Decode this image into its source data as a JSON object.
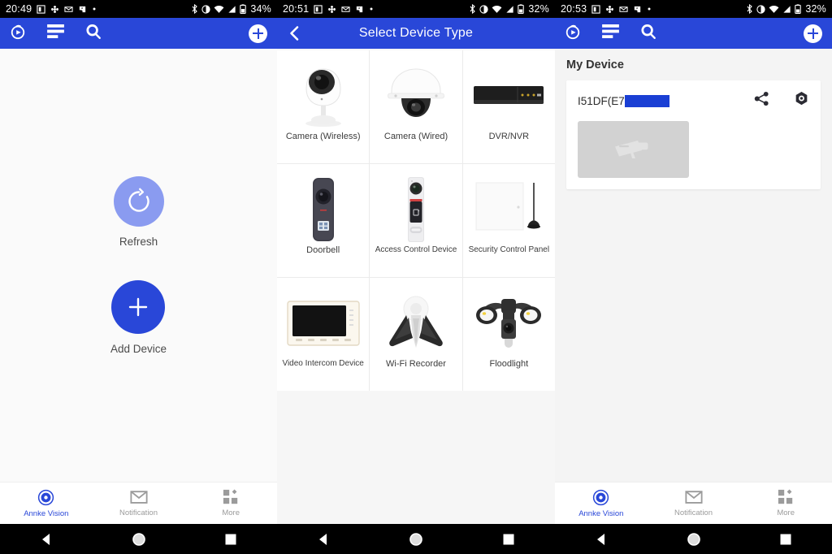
{
  "screens": [
    {
      "id": "device-list-empty",
      "status": {
        "time": "20:49",
        "battery": "34%",
        "icons": [
          "book-icon",
          "pinwheel-icon",
          "mail-icon",
          "puzzle-icon",
          "dot-icon"
        ],
        "right_icons": [
          "bluetooth-icon",
          "do-not-disturb-icon",
          "wifi-icon",
          "signal-icon",
          "battery-icon"
        ]
      },
      "app_bar": {
        "icons": [
          "live-view-icon",
          "playback-list-icon",
          "search-icon"
        ],
        "add_label": "+"
      },
      "actions": [
        {
          "label": "Refresh",
          "icon": "refresh-icon"
        },
        {
          "label": "Add Device",
          "icon": "plus-icon"
        }
      ],
      "bottom_nav": [
        {
          "label": "Annke Vision",
          "icon": "annke-vision-icon",
          "active": true
        },
        {
          "label": "Notification",
          "icon": "envelope-icon",
          "active": false
        },
        {
          "label": "More",
          "icon": "grid-more-icon",
          "active": false
        }
      ]
    },
    {
      "id": "select-device-type",
      "status": {
        "time": "20:51",
        "battery": "32%"
      },
      "app_bar": {
        "back_icon": "back-arrow-icon",
        "title": "Select Device Type"
      },
      "device_types": [
        {
          "label": "Camera (Wireless)",
          "icon": "wireless-camera-image"
        },
        {
          "label": "Camera (Wired)",
          "icon": "dome-camera-image"
        },
        {
          "label": "DVR/NVR",
          "icon": "dvr-nvr-image"
        },
        {
          "label": "Doorbell",
          "icon": "doorbell-image"
        },
        {
          "label": "Access Control Device",
          "icon": "access-control-image"
        },
        {
          "label": "Security Control Panel",
          "icon": "security-panel-image"
        },
        {
          "label": "Video Intercom Device",
          "icon": "video-intercom-image"
        },
        {
          "label": "Wi-Fi Recorder",
          "icon": "wifi-recorder-image"
        },
        {
          "label": "Floodlight",
          "icon": "floodlight-image"
        }
      ]
    },
    {
      "id": "my-device",
      "status": {
        "time": "20:53",
        "battery": "32%"
      },
      "app_bar": {
        "icons": [
          "live-view-icon",
          "playback-list-icon",
          "search-icon"
        ],
        "add_label": "+"
      },
      "section_title": "My Device",
      "device": {
        "name": "I51DF(E7",
        "name_redacted": true,
        "share_icon": "share-icon",
        "settings_icon": "gear-hex-icon",
        "thumbnail_icon": "camera-placeholder-icon"
      },
      "bottom_nav": [
        {
          "label": "Annke Vision",
          "icon": "annke-vision-icon",
          "active": true
        },
        {
          "label": "Notification",
          "icon": "envelope-icon",
          "active": false
        },
        {
          "label": "More",
          "icon": "grid-more-icon",
          "active": false
        }
      ]
    }
  ],
  "android_nav": {
    "back": "back-triangle-icon",
    "home": "home-circle-icon",
    "recents": "recents-square-icon"
  },
  "colors": {
    "primary": "#2947d8",
    "refresh_light": "#8a9bf0",
    "status_bar": "#000000",
    "redaction": "#1a3fd4"
  }
}
